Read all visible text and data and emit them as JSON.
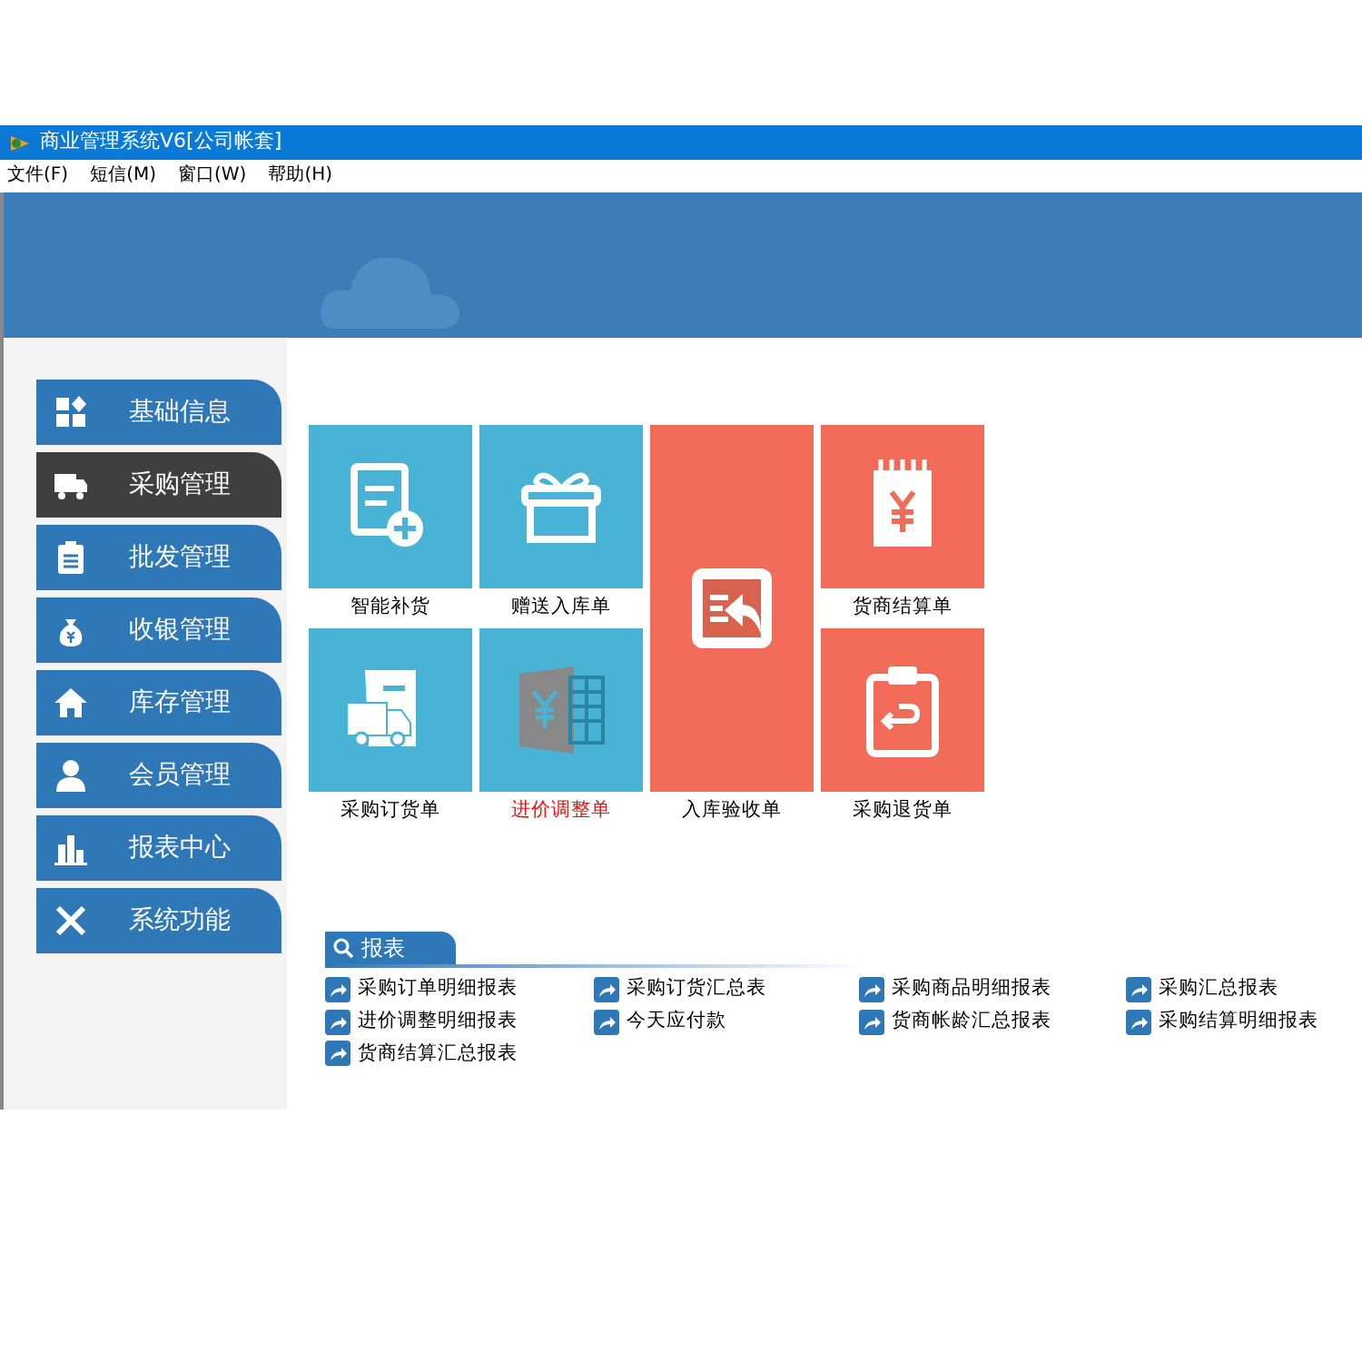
{
  "window": {
    "title": "商业管理系统V6[公司帐套]"
  },
  "menu": [
    "文件(F)",
    "短信(M)",
    "窗口(W)",
    "帮助(H)"
  ],
  "sidebar": {
    "items": [
      {
        "label": "基础信息",
        "selected": false
      },
      {
        "label": "采购管理",
        "selected": true
      },
      {
        "label": "批发管理",
        "selected": false
      },
      {
        "label": "收银管理",
        "selected": false
      },
      {
        "label": "库存管理",
        "selected": false
      },
      {
        "label": "会员管理",
        "selected": false
      },
      {
        "label": "报表中心",
        "selected": false
      },
      {
        "label": "系统功能",
        "selected": false
      }
    ]
  },
  "tiles": [
    {
      "label": "智能补货",
      "kind": "blue",
      "highlighted": false
    },
    {
      "label": "赠送入库单",
      "kind": "blue",
      "highlighted": false
    },
    {
      "label": "货商结算单",
      "kind": "red",
      "highlighted": false
    },
    {
      "label": "采购订货单",
      "kind": "blue",
      "highlighted": false
    },
    {
      "label": "进价调整单",
      "kind": "blue",
      "highlighted": true
    },
    {
      "label": "入库验收单",
      "kind": "red-tall",
      "highlighted": false
    },
    {
      "label": "采购退货单",
      "kind": "red",
      "highlighted": false
    }
  ],
  "reports": {
    "title": "报表",
    "links": [
      "采购订单明细报表",
      "采购订货汇总表",
      "采购商品明细报表",
      "采购汇总报表",
      "进价调整明细报表",
      "今天应付款",
      "货商帐龄汇总报表",
      "采购结算明细报表",
      "货商结算汇总报表"
    ]
  }
}
